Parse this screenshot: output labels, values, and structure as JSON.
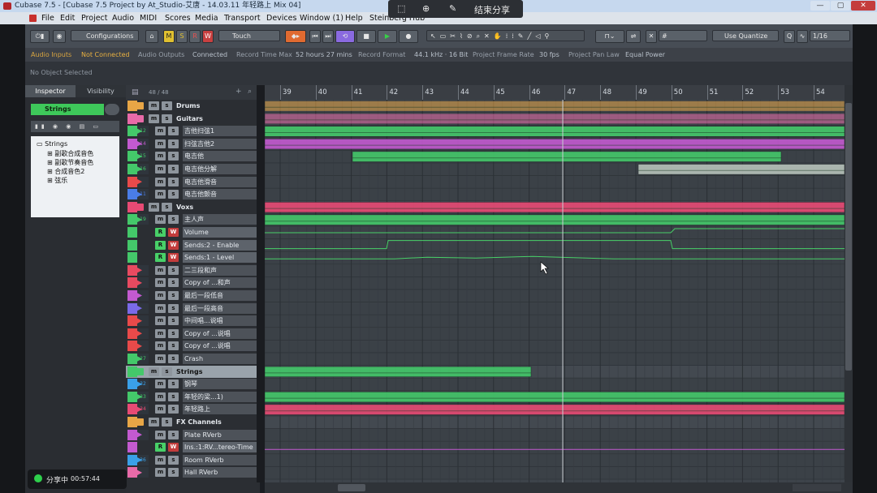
{
  "window": {
    "title": "Cubase 7.5 - [Cubase 7.5 Project by At_Studio-艾唐 - 14.03.11 年轻路上 Mix 04]",
    "minimize": "—",
    "maximize": "▢",
    "close": "✕"
  },
  "menu": [
    "File",
    "Edit",
    "Project",
    "Audio",
    "MIDI",
    "Scores",
    "Media",
    "Transport",
    "Devices",
    "Window (1)",
    "Help",
    "Steinberg Hub"
  ],
  "overlay": {
    "end_share": "结束分享"
  },
  "toolbar": {
    "configurations": "Configurations",
    "touch": "Touch",
    "m": "M",
    "s": "S",
    "r": "R",
    "w": "W",
    "use_quantize": "Use Quantize",
    "quantize_value": "1/16"
  },
  "infobar": {
    "audio_inputs": "Audio Inputs",
    "audio_inputs_val": "Not Connected",
    "audio_outputs": "Audio Outputs",
    "audio_outputs_val": "Connected",
    "record_time_max": "Record Time Max",
    "record_time_max_val": "52 hours 27 mins",
    "record_format": "Record Format",
    "record_format_val": "44.1 kHz · 16 Bit",
    "frame_rate": "Project Frame Rate",
    "frame_rate_val": "30 fps",
    "pan_law": "Project Pan Law",
    "pan_law_val": "Equal Power"
  },
  "status_line": "No Object Selected",
  "inspector": {
    "tab_inspector": "Inspector",
    "tab_visibility": "Visibility",
    "track_name": "Strings",
    "count": "48 / 48",
    "tree_root": "Strings",
    "tree_children": [
      "副歌合成音色",
      "副歌节奏音色",
      "合成音色2",
      "弦乐"
    ]
  },
  "tracks": [
    {
      "type": "folder",
      "name": "Drums",
      "color": "#e8a646"
    },
    {
      "type": "folder",
      "name": "Guitars",
      "color": "#e86aa8"
    },
    {
      "type": "inst",
      "num": "12",
      "name": "吉他扫弦1",
      "color": "#44c86a"
    },
    {
      "type": "inst",
      "num": "14",
      "name": "扫弦吉他2",
      "color": "#c35ad0"
    },
    {
      "type": "inst",
      "num": "15",
      "name": "电吉他",
      "color": "#44c86a"
    },
    {
      "type": "inst",
      "num": "16",
      "name": "电吉他分解",
      "color": "#44c86a"
    },
    {
      "type": "inst",
      "num": "",
      "name": "电吉他滑音",
      "color": "#e84a4a"
    },
    {
      "type": "inst",
      "num": "11",
      "name": "电吉他颤音",
      "color": "#4a7de8"
    },
    {
      "type": "folder",
      "name": "Voxs",
      "color": "#e84a74"
    },
    {
      "type": "inst",
      "num": "19",
      "name": "主人声",
      "color": "#44c86a"
    },
    {
      "type": "auto",
      "name": "Volume",
      "color": "#44c86a"
    },
    {
      "type": "auto",
      "name": "Sends:2 - Enable",
      "color": "#44c86a"
    },
    {
      "type": "auto",
      "name": "Sends:1 - Level",
      "color": "#44c86a"
    },
    {
      "type": "inst",
      "num": "",
      "name": "二三段和声",
      "color": "#e84a60"
    },
    {
      "type": "inst",
      "num": "",
      "name": "Copy of ...和声",
      "color": "#e84a60"
    },
    {
      "type": "inst",
      "num": "",
      "name": "最后一段低音",
      "color": "#c35ad0"
    },
    {
      "type": "inst",
      "num": "",
      "name": "最后一段高音",
      "color": "#7a6ae8"
    },
    {
      "type": "inst",
      "num": "",
      "name": "中间唱...说唱",
      "color": "#e84a4a"
    },
    {
      "type": "inst",
      "num": "",
      "name": "Copy of ...说唱",
      "color": "#e84a4a"
    },
    {
      "type": "inst",
      "num": "",
      "name": "Copy of ...说唱",
      "color": "#e84a4a"
    },
    {
      "type": "inst",
      "num": "27",
      "name": "Crash",
      "color": "#44c86a"
    },
    {
      "type": "folder",
      "name": "Strings",
      "color": "#44c86a",
      "selected": true
    },
    {
      "type": "inst",
      "num": "32",
      "name": "钢琴",
      "color": "#3aa0e8"
    },
    {
      "type": "inst",
      "num": "33",
      "name": "年轻的梁...1)",
      "color": "#44c86a"
    },
    {
      "type": "inst",
      "num": "34",
      "name": "年轻路上",
      "color": "#e84a74"
    },
    {
      "type": "folder",
      "name": "FX Channels",
      "color": "#e8a646"
    },
    {
      "type": "inst",
      "num": "",
      "name": "Plate RVerb",
      "color": "#c35ad0"
    },
    {
      "type": "auto",
      "name": "Ins.:1:RV...tereo-Time",
      "color": "#c35ad0"
    },
    {
      "type": "inst",
      "num": "36",
      "name": "Room RVerb",
      "color": "#3aa0e8"
    },
    {
      "type": "inst",
      "num": "",
      "name": "Hall RVerb",
      "color": "#e86aa8"
    }
  ],
  "ruler": [
    "39",
    "40",
    "41",
    "42",
    "43",
    "44",
    "45",
    "46",
    "47",
    "48",
    "49",
    "50",
    "51",
    "52",
    "53",
    "54"
  ],
  "share_status": {
    "label": "分享中",
    "time": "00:57:44"
  },
  "colors": {
    "accent": "#44c86a",
    "pink": "#e84a74",
    "orange": "#e8a646",
    "purple": "#c35ad0"
  }
}
